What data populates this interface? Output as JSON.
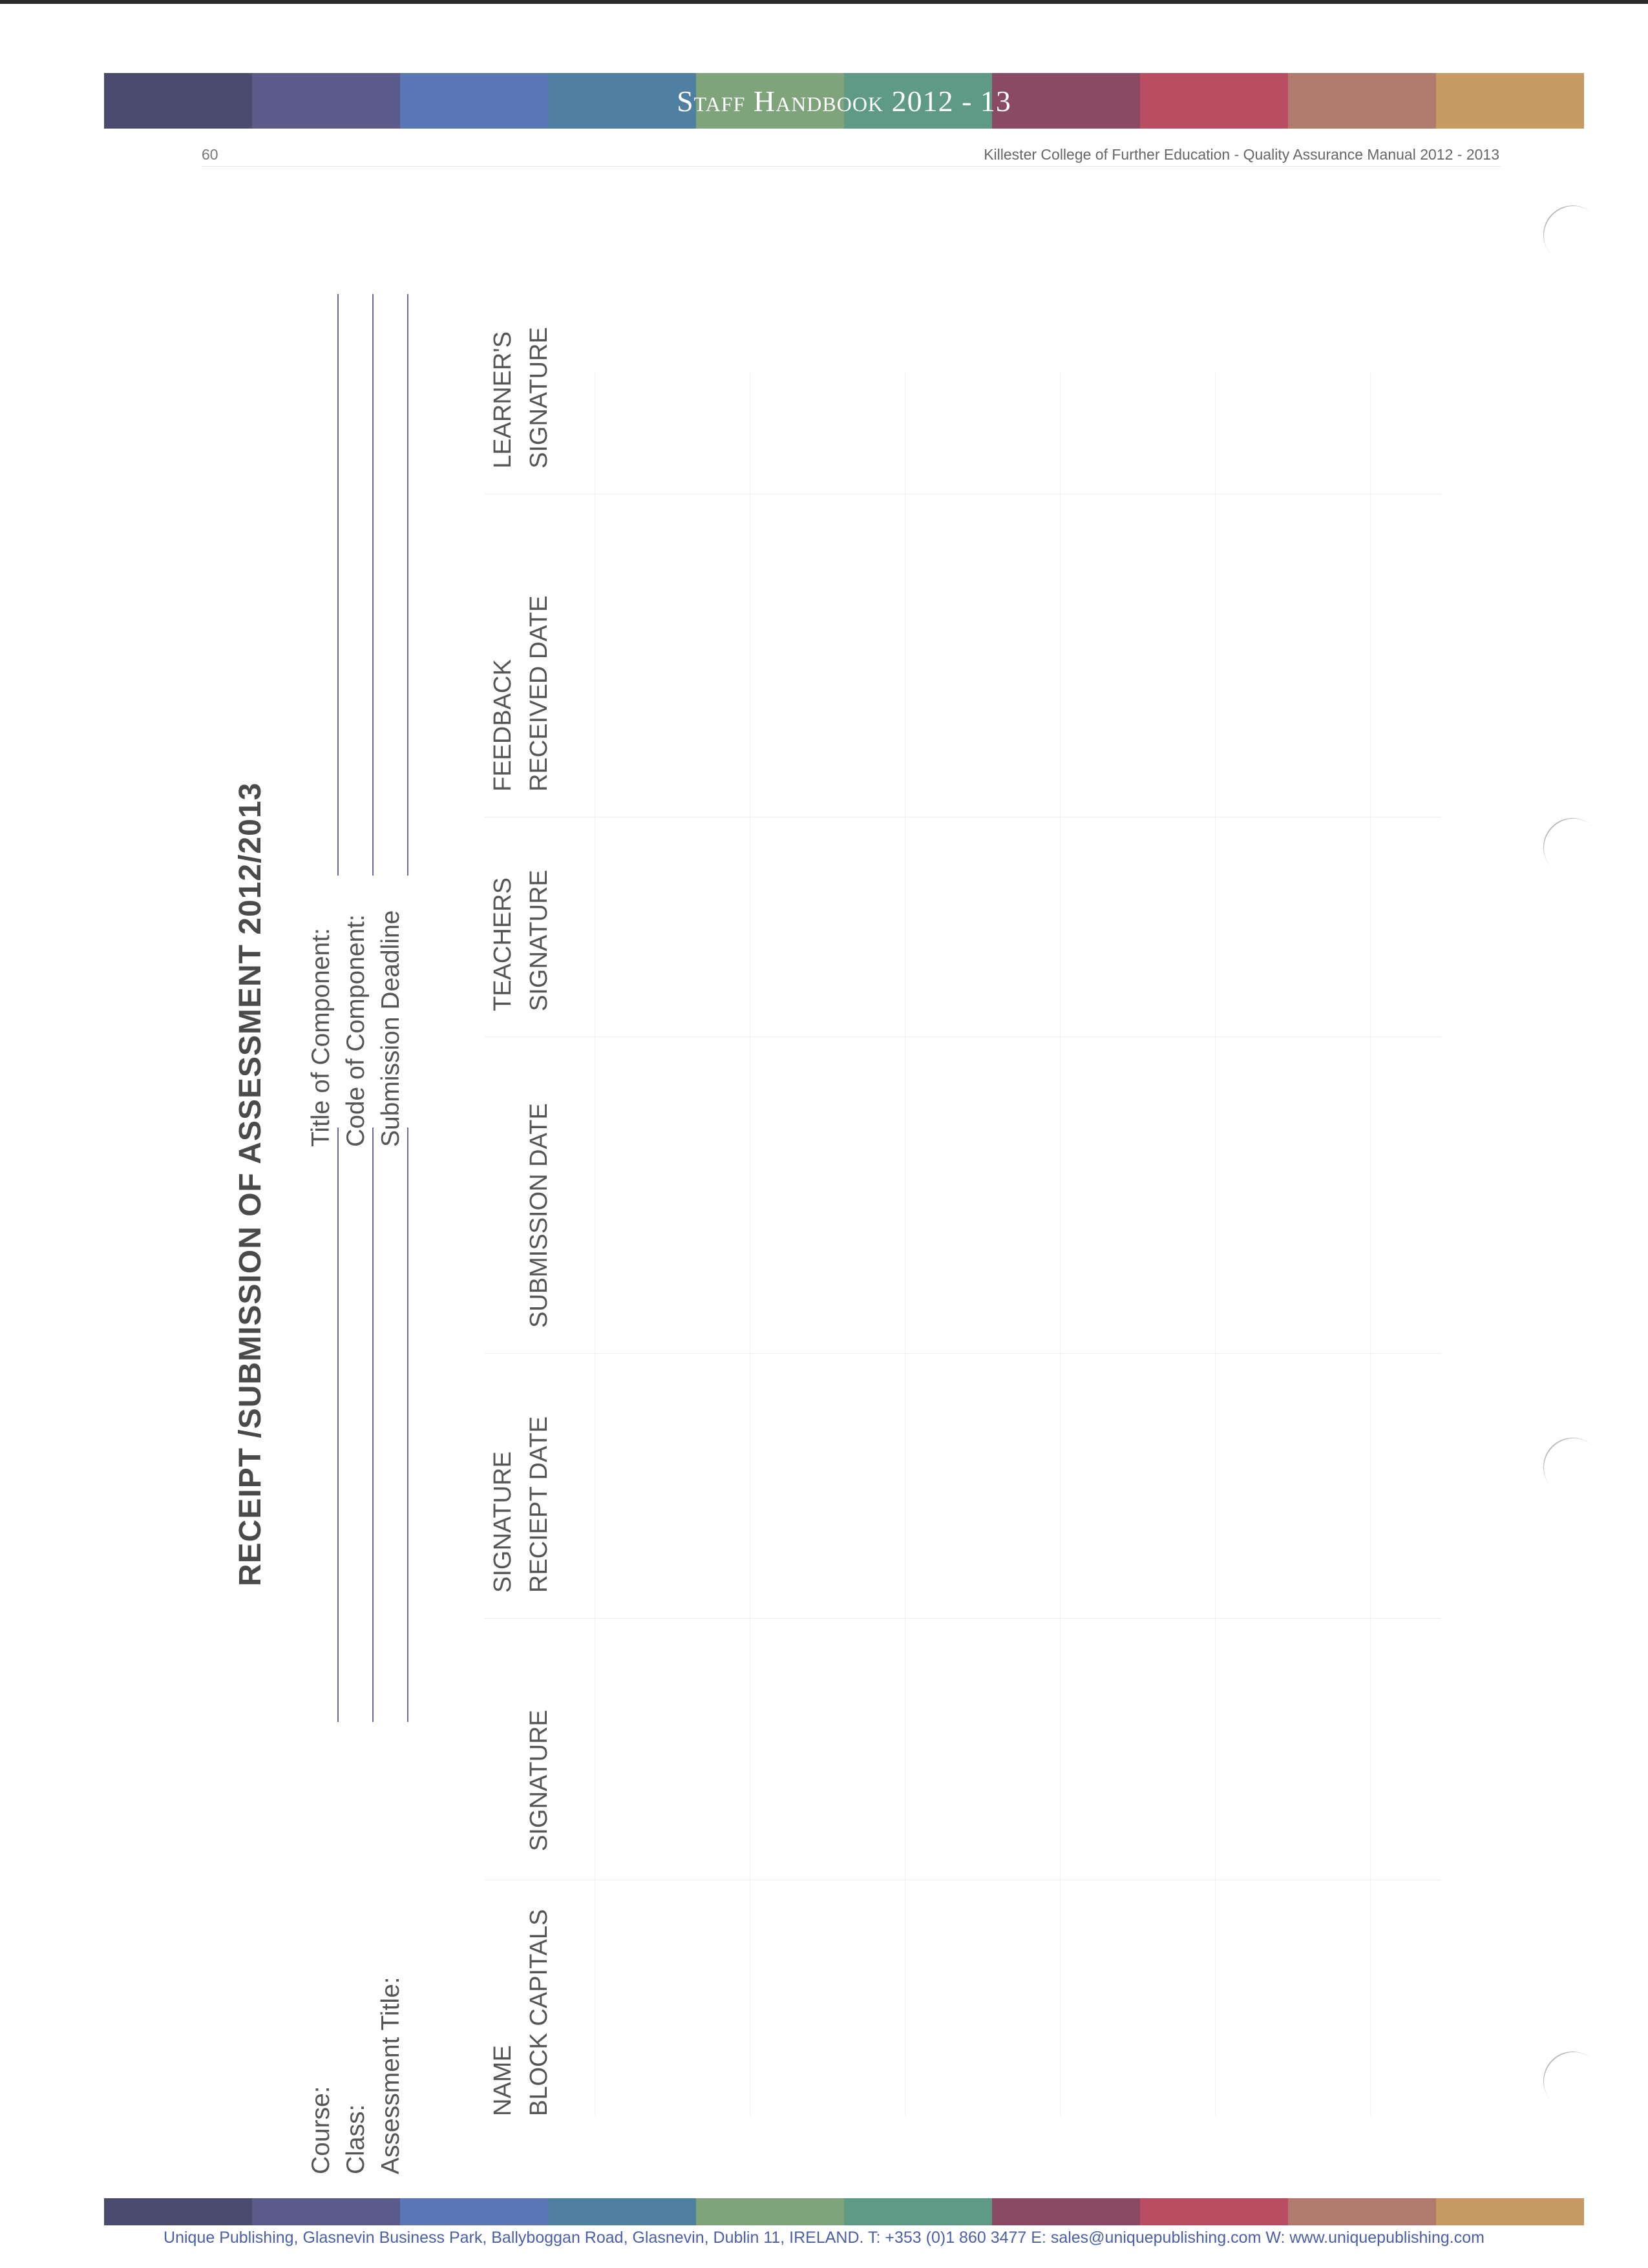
{
  "header": {
    "band_title": "Staff Handbook 2012 - 13",
    "page_number": "60",
    "manual_title": "Killester College of Further Education - Quality Assurance Manual 2012 - 2013"
  },
  "band_colors": [
    "#4a4b6e",
    "#5a5b8a",
    "#5b76b4",
    "#4f80a2",
    "#7fa37a",
    "#5f9a86",
    "#8a4a64",
    "#b94e62",
    "#b07a6e",
    "#c69a62"
  ],
  "form": {
    "title": "RECEIPT /SUBMISSION OF ASSESSMENT 2012/2013",
    "fields": {
      "course": "Course:",
      "class": "Class:",
      "assessment_title": "Assessment Title:",
      "title_of_component": "Title of Component:",
      "code_of_component": "Code of Component:",
      "submission_deadline": "Submission Deadline"
    },
    "columns": [
      {
        "line1": "NAME",
        "line2": "BLOCK CAPITALS"
      },
      {
        "line1": "",
        "line2": "SIGNATURE"
      },
      {
        "line1": "SIGNATURE",
        "line2": "RECIEPT DATE"
      },
      {
        "line1": "",
        "line2": "SUBMISSION DATE"
      },
      {
        "line1": "TEACHERS",
        "line2": "SIGNATURE"
      },
      {
        "line1": "FEEDBACK",
        "line2": "RECEIVED DATE"
      },
      {
        "line1": "LEARNER'S",
        "line2": "SIGNATURE"
      }
    ]
  },
  "footer": {
    "text": "Unique Publishing, Glasnevin Business Park, Ballyboggan Road, Glasnevin, Dublin 11, IRELAND.  T: +353 (0)1 860 3477  E: sales@uniquepublishing.com   W: www.uniquepublishing.com"
  }
}
